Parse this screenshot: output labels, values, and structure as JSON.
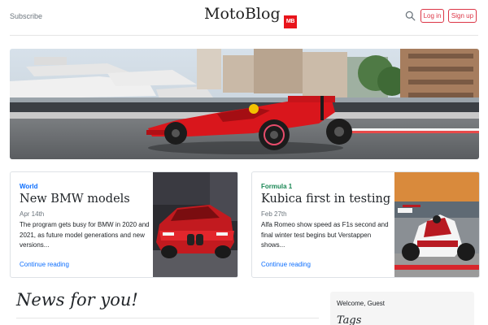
{
  "header": {
    "subscribe_label": "Subscribe",
    "brand": "MotoBlog",
    "brand_badge": "MB",
    "login_label": "Log in",
    "signup_label": "Sign up",
    "search_icon": "search-icon",
    "accent_color": "#dc3545"
  },
  "hero": {
    "image": "Formula 1 car on track with harbor and yachts in background"
  },
  "cards": [
    {
      "category": "World",
      "category_color": "#0d6efd",
      "title": "New BMW models",
      "date": "Apr 14th",
      "text": "The program gets busy for BMW in 2020 and 2021, as future model generations and new versions...",
      "link_label": "Continue reading"
    },
    {
      "category": "Formula 1",
      "category_color": "#198754",
      "title": "Kubica first in testing",
      "date": "Feb 27th",
      "text": "Alfa Romeo show speed as F1s second and final winter test begins but Verstappen shows...",
      "link_label": "Continue reading"
    }
  ],
  "main": {
    "news_heading": "News for you!"
  },
  "sidebar": {
    "welcome": "Welcome, Guest",
    "tags_heading": "Tags"
  }
}
